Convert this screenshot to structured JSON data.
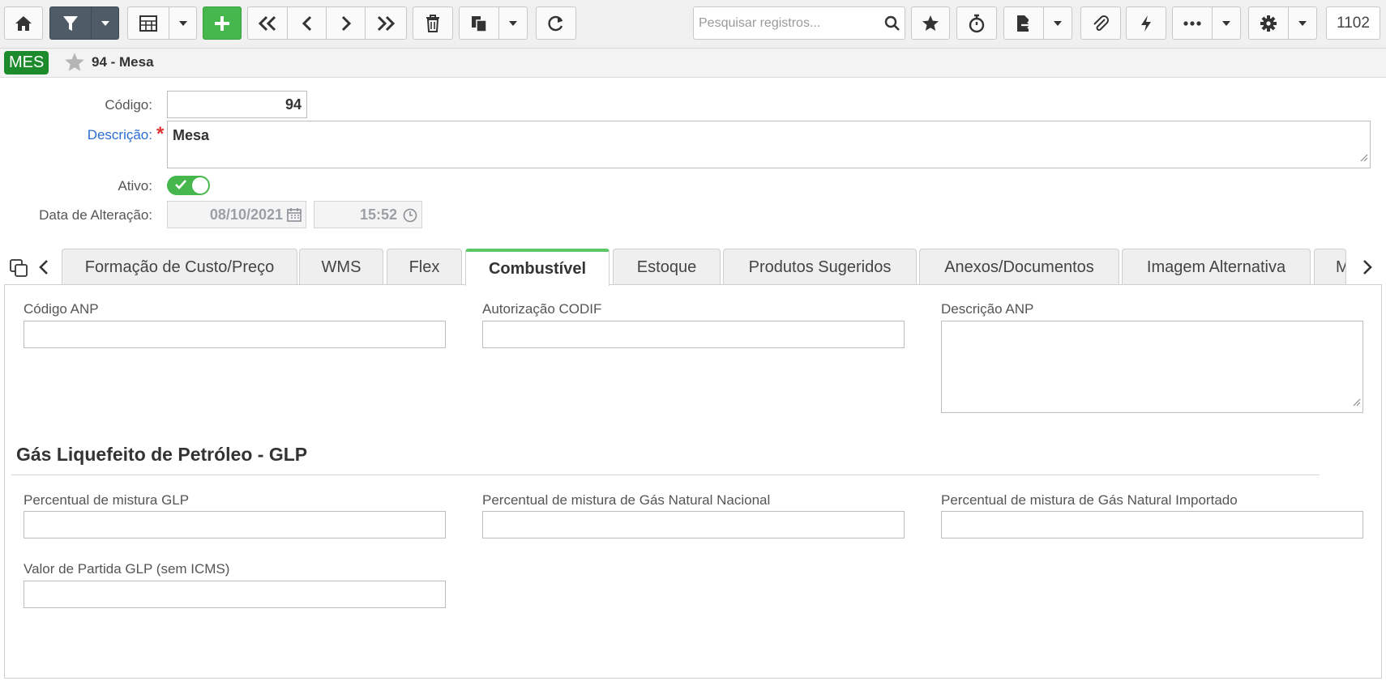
{
  "toolbar": {
    "search_placeholder": "Pesquisar registros...",
    "record_counter": "1102",
    "icons": [
      "home-icon",
      "filter-icon",
      "grid-icon",
      "plus-icon",
      "first-icon",
      "prev-icon",
      "next-icon",
      "last-icon",
      "trash-icon",
      "copy-icon",
      "refresh-icon",
      "search-icon",
      "star-icon",
      "timer-icon",
      "export-icon",
      "attach-icon",
      "bolt-icon",
      "more-icon",
      "gear-icon"
    ]
  },
  "header": {
    "badge": "MES",
    "title": "94 - Mesa"
  },
  "form": {
    "codigo_label": "Código:",
    "codigo_value": "94",
    "descricao_label": "Descrição:",
    "descricao_required": "*",
    "descricao_value": "Mesa",
    "ativo_label": "Ativo:",
    "ativo_on": true,
    "data_alteracao_label": "Data de Alteração:",
    "data_value": "08/10/2021",
    "hora_value": "15:52"
  },
  "tabs": [
    {
      "label": "Formação de Custo/Preço",
      "active": false
    },
    {
      "label": "WMS",
      "active": false
    },
    {
      "label": "Flex",
      "active": false
    },
    {
      "label": "Combustível",
      "active": true
    },
    {
      "label": "Estoque",
      "active": false
    },
    {
      "label": "Produtos Sugeridos",
      "active": false
    },
    {
      "label": "Anexos/Documentos",
      "active": false
    },
    {
      "label": "Imagem Alternativa",
      "active": false
    },
    {
      "label": "M",
      "active": false
    }
  ],
  "combustivel": {
    "codigo_anp_label": "Código ANP",
    "autorizacao_codif_label": "Autorização CODIF",
    "descricao_anp_label": "Descrição ANP",
    "glp_section_title": "Gás Liquefeito de Petróleo - GLP",
    "perc_glp_label": "Percentual de mistura GLP",
    "perc_gnn_label": "Percentual de mistura de Gás Natural Nacional",
    "perc_gni_label": "Percentual de mistura de Gás Natural Importado",
    "valor_partida_label": "Valor de Partida GLP (sem ICMS)"
  },
  "colors": {
    "accent_green": "#45b74c",
    "badge_green": "#1d8a2c",
    "filter_dark": "#4f5b66",
    "required_red": "#dd3333",
    "link_blue": "#2a6ed3"
  }
}
